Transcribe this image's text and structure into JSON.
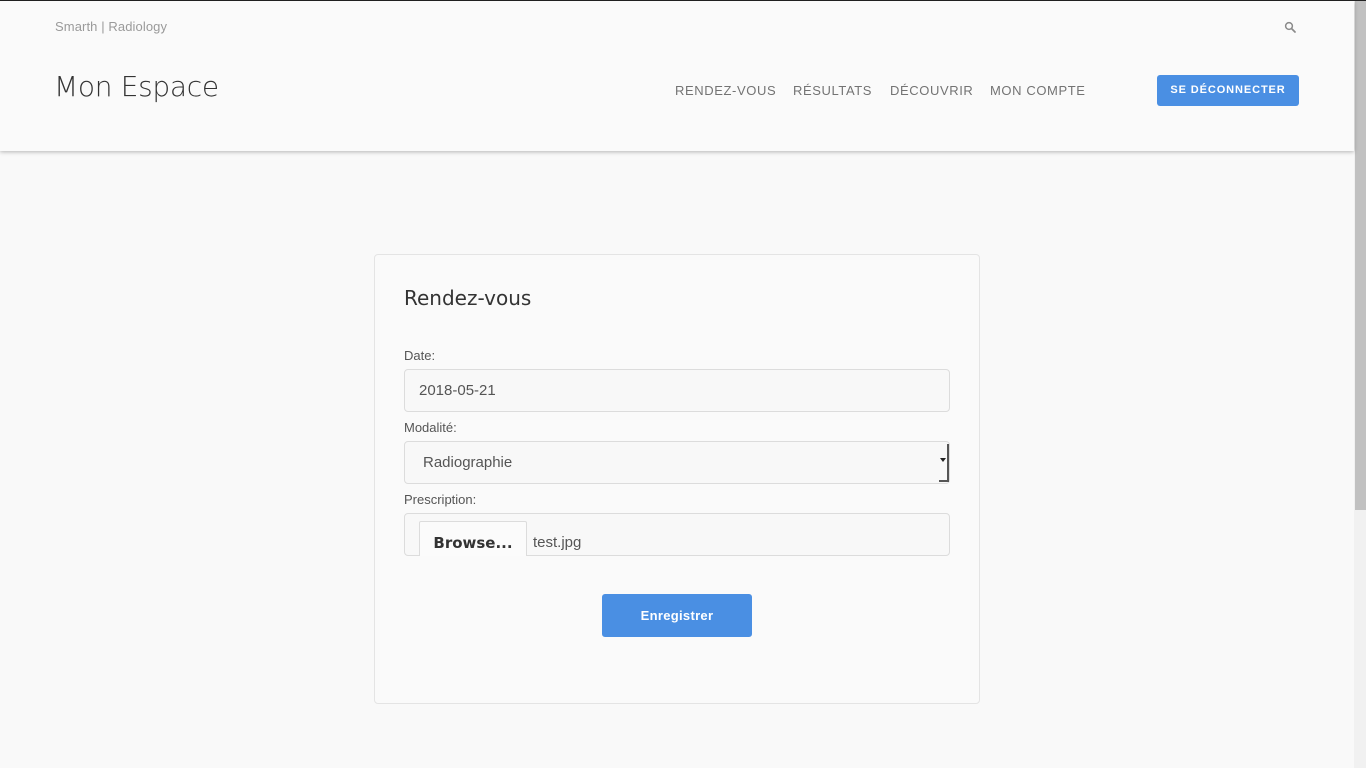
{
  "header": {
    "brand_small": "Smarth | Radiology",
    "site_title": "Mon Espace",
    "nav": [
      "RENDEZ-VOUS",
      "RÉSULTATS",
      "DÉCOUVRIR",
      "MON COMPTE"
    ],
    "logout_label": "SE DÉCONNECTER",
    "search_icon": "search-icon"
  },
  "form": {
    "title": "Rendez-vous",
    "date_label": "Date:",
    "date_value": "2018-05-21",
    "modality_label": "Modalité:",
    "modality_value": "Radiographie",
    "prescription_label": "Prescription:",
    "browse_label": "Browse...",
    "file_name": "test.jpg",
    "submit_label": "Enregistrer"
  },
  "colors": {
    "accent": "#4a8fe3",
    "background": "#f9f9f9"
  }
}
